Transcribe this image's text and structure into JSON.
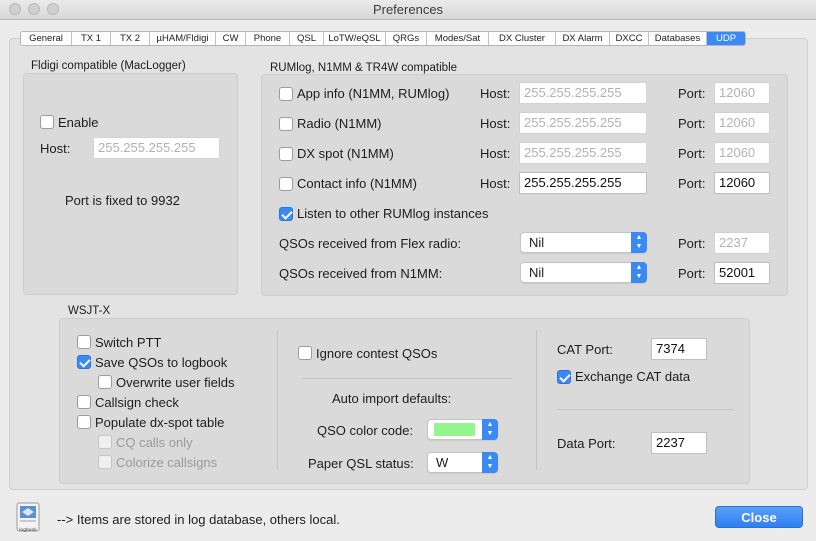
{
  "window": {
    "title": "Preferences"
  },
  "tabs": [
    {
      "label": "General"
    },
    {
      "label": "TX 1"
    },
    {
      "label": "TX 2"
    },
    {
      "label": "µHAM/Fldigi"
    },
    {
      "label": "CW"
    },
    {
      "label": "Phone"
    },
    {
      "label": "QSL"
    },
    {
      "label": "LoTW/eQSL"
    },
    {
      "label": "QRGs"
    },
    {
      "label": "Modes/Sat"
    },
    {
      "label": "DX Cluster"
    },
    {
      "label": "DX Alarm"
    },
    {
      "label": "DXCC"
    },
    {
      "label": "Databases"
    },
    {
      "label": "UDP",
      "active": true
    }
  ],
  "fldigi": {
    "title": "Fldigi compatible (MacLogger)",
    "enable_label": "Enable",
    "enable_checked": false,
    "host_label": "Host:",
    "host_placeholder": "255.255.255.255",
    "port_note": "Port is fixed to 9932"
  },
  "rumlog": {
    "title": "RUMlog, N1MM & TR4W compatible",
    "host_label": "Host:",
    "port_label": "Port:",
    "rows": [
      {
        "label": "App info (N1MM, RUMlog)",
        "checked": false,
        "host": "255.255.255.255",
        "port": "12060",
        "enabled": false
      },
      {
        "label": "Radio (N1MM)",
        "checked": false,
        "host": "255.255.255.255",
        "port": "12060",
        "enabled": false
      },
      {
        "label": "DX spot (N1MM)",
        "checked": false,
        "host": "255.255.255.255",
        "port": "12060",
        "enabled": false
      },
      {
        "label": "Contact info (N1MM)",
        "checked": false,
        "host": "255.255.255.255",
        "port": "12060",
        "enabled": true
      }
    ],
    "listen_label": "Listen to other RUMlog instances",
    "listen_checked": true,
    "flex_label": "QSOs received from Flex radio:",
    "flex_value": "Nil",
    "flex_port": "2237",
    "n1mm_label": "QSOs received from N1MM:",
    "n1mm_value": "Nil",
    "n1mm_port": "52001"
  },
  "wsjtx": {
    "title": "WSJT-X",
    "left": [
      {
        "label": "Switch PTT",
        "checked": false,
        "enabled": true
      },
      {
        "label": "Save QSOs to logbook",
        "checked": true,
        "enabled": true
      },
      {
        "label": "Overwrite user fields",
        "checked": false,
        "enabled": true
      },
      {
        "label": "Callsign check",
        "checked": false,
        "enabled": true
      },
      {
        "label": "Populate dx-spot table",
        "checked": false,
        "enabled": true
      },
      {
        "label": "CQ calls only",
        "checked": false,
        "enabled": false
      },
      {
        "label": "Colorize callsigns",
        "checked": false,
        "enabled": false
      }
    ],
    "ignore_contest_label": "Ignore contest QSOs",
    "ignore_contest_checked": false,
    "auto_import_label": "Auto import defaults:",
    "qso_color_label": "QSO color code:",
    "qso_color": "#95f68f",
    "paper_qsl_label": "Paper QSL status:",
    "paper_qsl_value": "W",
    "cat_port_label": "CAT Port:",
    "cat_port": "7374",
    "exchange_cat_label": "Exchange CAT data",
    "exchange_cat_checked": true,
    "data_port_label": "Data Port:",
    "data_port": "2237"
  },
  "footer": {
    "note": "--> Items are stored in log database, others local.",
    "icon_caption": "logbook",
    "close_label": "Close"
  },
  "colors": {
    "accent": "#3b89f4"
  }
}
